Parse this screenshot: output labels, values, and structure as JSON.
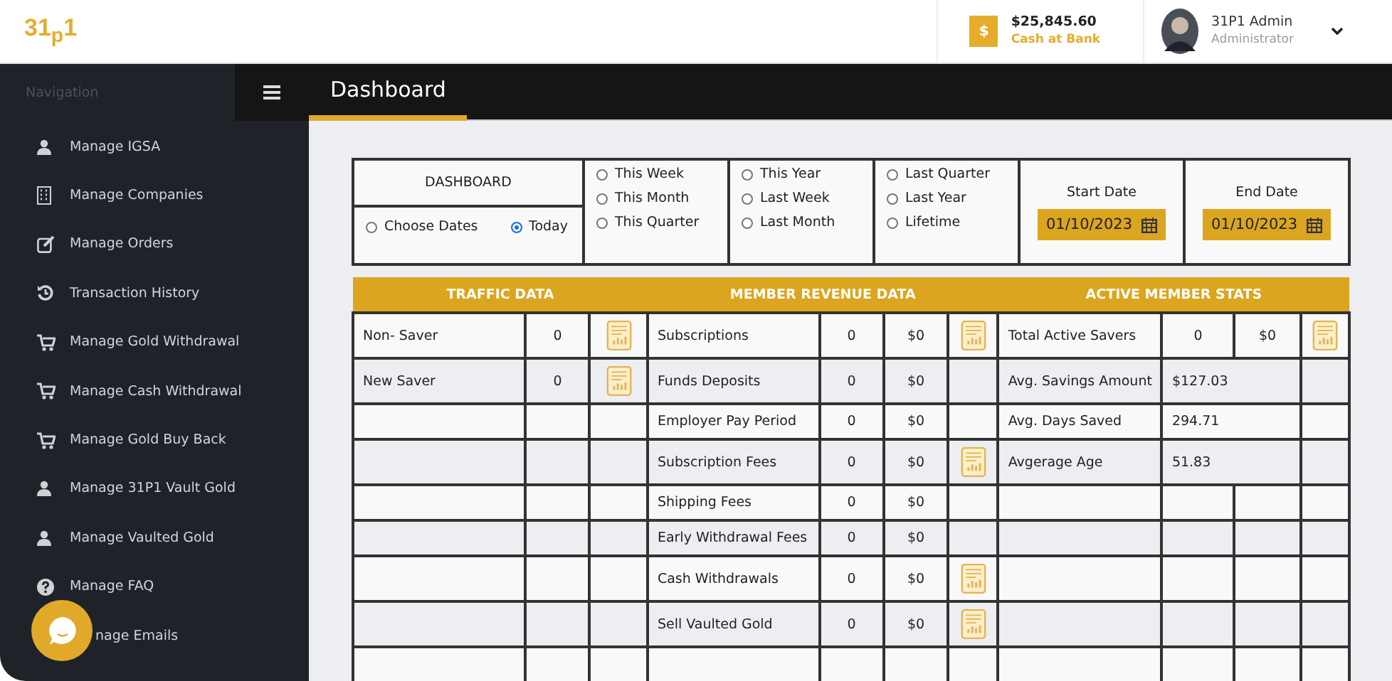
{
  "header": {
    "logo": "31$_{p}$1",
    "cash": {
      "symbol": "$",
      "amount": "$25,845.60",
      "label": "Cash at Bank"
    },
    "user": {
      "name": "31P1 Admin",
      "role": "Administrator"
    }
  },
  "sidebar": {
    "heading": "Navigation",
    "items": [
      {
        "label": "Manage IGSA"
      },
      {
        "label": "Manage Companies"
      },
      {
        "label": "Manage Orders"
      },
      {
        "label": "Transaction History"
      },
      {
        "label": "Manage Gold Withdrawal"
      },
      {
        "label": "Manage Cash Withdrawal"
      },
      {
        "label": "Manage Gold Buy Back"
      },
      {
        "label": "Manage 31P1 Vault Gold"
      },
      {
        "label": "Manage Vaulted Gold"
      },
      {
        "label": "Manage FAQ"
      },
      {
        "label": "nage Emails"
      }
    ]
  },
  "page_title": "Dashboard",
  "filters": {
    "title": "DASHBOARD",
    "groups": [
      [
        {
          "label": "Choose Dates",
          "selected": false
        },
        {
          "label": "Today",
          "selected": true
        }
      ],
      [
        {
          "label": "This Week",
          "selected": false
        },
        {
          "label": "This Month",
          "selected": false
        },
        {
          "label": "This Quarter",
          "selected": false
        }
      ],
      [
        {
          "label": "This Year",
          "selected": false
        },
        {
          "label": "Last Week",
          "selected": false
        },
        {
          "label": "Last Month",
          "selected": false
        }
      ],
      [
        {
          "label": "Last Quarter",
          "selected": false
        },
        {
          "label": "Last Year",
          "selected": false
        },
        {
          "label": "Lifetime",
          "selected": false
        }
      ]
    ],
    "start_date": {
      "label": "Start Date",
      "value": "01/10/2023"
    },
    "end_date": {
      "label": "End Date",
      "value": "01/10/2023"
    }
  },
  "table": {
    "sections": [
      "TRAFFIC DATA",
      "MEMBER REVENUE DATA",
      "ACTIVE MEMBER STATS"
    ],
    "rows": [
      {
        "traffic": {
          "label": "Non- Saver",
          "value": "0",
          "report": true
        },
        "revenue": {
          "label": "Subscriptions",
          "count": "0",
          "amount": "$0",
          "report": true
        },
        "stats": {
          "kind": "split",
          "label": "Total Active Savers",
          "value": "0",
          "amount": "$0",
          "report": true
        }
      },
      {
        "traffic": {
          "label": "New Saver",
          "value": "0",
          "report": true
        },
        "revenue": {
          "label": "Funds Deposits",
          "count": "0",
          "amount": "$0",
          "report": false
        },
        "stats": {
          "kind": "merged",
          "label": "Avg. Savings Amount",
          "value": "$127.03",
          "report": false
        }
      },
      {
        "traffic": {
          "report": false
        },
        "revenue": {
          "label": "Employer Pay Period",
          "count": "0",
          "amount": "$0",
          "report": false
        },
        "stats": {
          "kind": "merged",
          "label": "Avg. Days Saved",
          "value": "294.71",
          "report": false
        }
      },
      {
        "traffic": {
          "report": false
        },
        "revenue": {
          "label": "Subscription Fees",
          "count": "0",
          "amount": "$0",
          "report": true
        },
        "stats": {
          "kind": "merged",
          "label": "Avgerage Age",
          "value": "51.83",
          "report": false
        }
      },
      {
        "traffic": {
          "report": false
        },
        "revenue": {
          "label": "Shipping Fees",
          "count": "0",
          "amount": "$0",
          "report": false
        },
        "stats": {
          "kind": "split",
          "report": false
        }
      },
      {
        "traffic": {
          "report": false
        },
        "revenue": {
          "label": "Early Withdrawal Fees",
          "count": "0",
          "amount": "$0",
          "report": false
        },
        "stats": {
          "kind": "split",
          "report": false
        }
      },
      {
        "traffic": {
          "report": false
        },
        "revenue": {
          "label": "Cash Withdrawals",
          "count": "0",
          "amount": "$0",
          "report": true
        },
        "stats": {
          "kind": "split",
          "report": false
        }
      },
      {
        "traffic": {
          "report": false
        },
        "revenue": {
          "label": "Sell Vaulted Gold",
          "count": "0",
          "amount": "$0",
          "report": true
        },
        "stats": {
          "kind": "split",
          "report": false
        }
      },
      {
        "traffic": {
          "report": false
        },
        "revenue": {
          "report": false
        },
        "stats": {
          "kind": "split",
          "report": false
        }
      }
    ]
  }
}
